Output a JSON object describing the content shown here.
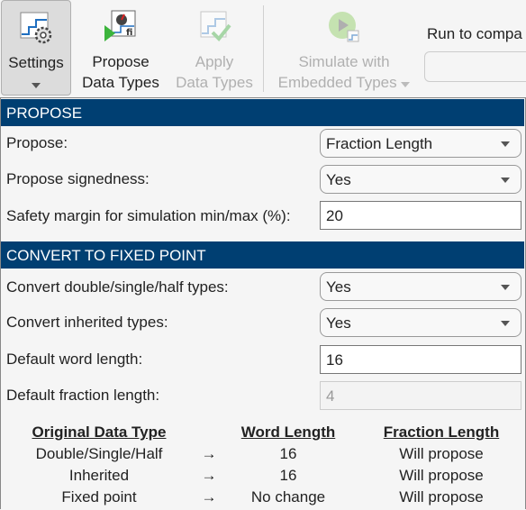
{
  "toolstrip": {
    "settings": {
      "label": "Settings",
      "icon": "settings-gear-icon"
    },
    "propose": {
      "label_line1": "Propose",
      "label_line2": "Data Types",
      "icon": "propose-data-types-icon"
    },
    "apply": {
      "label_line1": "Apply",
      "label_line2": "Data Types",
      "icon": "apply-data-types-icon",
      "enabled": false
    },
    "simulate": {
      "label_line1": "Simulate with",
      "label_line2": "Embedded Types",
      "icon": "simulate-play-icon",
      "enabled": false
    },
    "run_to_compare": {
      "label": "Run to compa",
      "value": ""
    }
  },
  "propose_section": {
    "title": "PROPOSE",
    "propose": {
      "label": "Propose:",
      "value": "Fraction Length"
    },
    "signedness": {
      "label": "Propose signedness:",
      "value": "Yes"
    },
    "safety_margin": {
      "label": "Safety margin for simulation min/max (%):",
      "value": "20"
    }
  },
  "convert_section": {
    "title": "CONVERT TO FIXED POINT",
    "convert_double": {
      "label": "Convert double/single/half types:",
      "value": "Yes"
    },
    "convert_inherited": {
      "label": "Convert inherited types:",
      "value": "Yes"
    },
    "word_length": {
      "label": "Default word length:",
      "value": "16"
    },
    "fraction_length": {
      "label": "Default fraction length:",
      "value": "4"
    }
  },
  "summary_table": {
    "headers": {
      "original": "Original Data Type",
      "word": "Word Length",
      "fraction": "Fraction Length"
    },
    "rows": [
      {
        "original": "Double/Single/Half",
        "arrow": "→",
        "word": "16",
        "fraction": "Will propose"
      },
      {
        "original": "Inherited",
        "arrow": "→",
        "word": "16",
        "fraction": "Will propose"
      },
      {
        "original": "Fixed point",
        "arrow": "→",
        "word": "No change",
        "fraction": "Will propose"
      }
    ]
  }
}
